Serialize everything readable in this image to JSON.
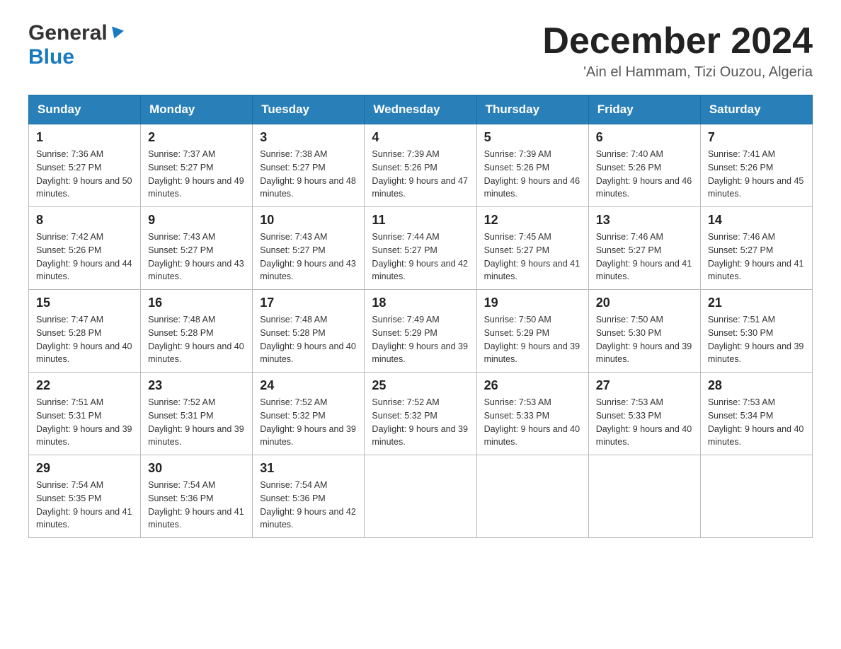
{
  "header": {
    "logo_general": "General",
    "logo_blue": "Blue",
    "title": "December 2024",
    "subtitle": "'Ain el Hammam, Tizi Ouzou, Algeria"
  },
  "weekdays": [
    "Sunday",
    "Monday",
    "Tuesday",
    "Wednesday",
    "Thursday",
    "Friday",
    "Saturday"
  ],
  "weeks": [
    [
      {
        "day": "1",
        "sunrise": "7:36 AM",
        "sunset": "5:27 PM",
        "daylight": "9 hours and 50 minutes."
      },
      {
        "day": "2",
        "sunrise": "7:37 AM",
        "sunset": "5:27 PM",
        "daylight": "9 hours and 49 minutes."
      },
      {
        "day": "3",
        "sunrise": "7:38 AM",
        "sunset": "5:27 PM",
        "daylight": "9 hours and 48 minutes."
      },
      {
        "day": "4",
        "sunrise": "7:39 AM",
        "sunset": "5:26 PM",
        "daylight": "9 hours and 47 minutes."
      },
      {
        "day": "5",
        "sunrise": "7:39 AM",
        "sunset": "5:26 PM",
        "daylight": "9 hours and 46 minutes."
      },
      {
        "day": "6",
        "sunrise": "7:40 AM",
        "sunset": "5:26 PM",
        "daylight": "9 hours and 46 minutes."
      },
      {
        "day": "7",
        "sunrise": "7:41 AM",
        "sunset": "5:26 PM",
        "daylight": "9 hours and 45 minutes."
      }
    ],
    [
      {
        "day": "8",
        "sunrise": "7:42 AM",
        "sunset": "5:26 PM",
        "daylight": "9 hours and 44 minutes."
      },
      {
        "day": "9",
        "sunrise": "7:43 AM",
        "sunset": "5:27 PM",
        "daylight": "9 hours and 43 minutes."
      },
      {
        "day": "10",
        "sunrise": "7:43 AM",
        "sunset": "5:27 PM",
        "daylight": "9 hours and 43 minutes."
      },
      {
        "day": "11",
        "sunrise": "7:44 AM",
        "sunset": "5:27 PM",
        "daylight": "9 hours and 42 minutes."
      },
      {
        "day": "12",
        "sunrise": "7:45 AM",
        "sunset": "5:27 PM",
        "daylight": "9 hours and 41 minutes."
      },
      {
        "day": "13",
        "sunrise": "7:46 AM",
        "sunset": "5:27 PM",
        "daylight": "9 hours and 41 minutes."
      },
      {
        "day": "14",
        "sunrise": "7:46 AM",
        "sunset": "5:27 PM",
        "daylight": "9 hours and 41 minutes."
      }
    ],
    [
      {
        "day": "15",
        "sunrise": "7:47 AM",
        "sunset": "5:28 PM",
        "daylight": "9 hours and 40 minutes."
      },
      {
        "day": "16",
        "sunrise": "7:48 AM",
        "sunset": "5:28 PM",
        "daylight": "9 hours and 40 minutes."
      },
      {
        "day": "17",
        "sunrise": "7:48 AM",
        "sunset": "5:28 PM",
        "daylight": "9 hours and 40 minutes."
      },
      {
        "day": "18",
        "sunrise": "7:49 AM",
        "sunset": "5:29 PM",
        "daylight": "9 hours and 39 minutes."
      },
      {
        "day": "19",
        "sunrise": "7:50 AM",
        "sunset": "5:29 PM",
        "daylight": "9 hours and 39 minutes."
      },
      {
        "day": "20",
        "sunrise": "7:50 AM",
        "sunset": "5:30 PM",
        "daylight": "9 hours and 39 minutes."
      },
      {
        "day": "21",
        "sunrise": "7:51 AM",
        "sunset": "5:30 PM",
        "daylight": "9 hours and 39 minutes."
      }
    ],
    [
      {
        "day": "22",
        "sunrise": "7:51 AM",
        "sunset": "5:31 PM",
        "daylight": "9 hours and 39 minutes."
      },
      {
        "day": "23",
        "sunrise": "7:52 AM",
        "sunset": "5:31 PM",
        "daylight": "9 hours and 39 minutes."
      },
      {
        "day": "24",
        "sunrise": "7:52 AM",
        "sunset": "5:32 PM",
        "daylight": "9 hours and 39 minutes."
      },
      {
        "day": "25",
        "sunrise": "7:52 AM",
        "sunset": "5:32 PM",
        "daylight": "9 hours and 39 minutes."
      },
      {
        "day": "26",
        "sunrise": "7:53 AM",
        "sunset": "5:33 PM",
        "daylight": "9 hours and 40 minutes."
      },
      {
        "day": "27",
        "sunrise": "7:53 AM",
        "sunset": "5:33 PM",
        "daylight": "9 hours and 40 minutes."
      },
      {
        "day": "28",
        "sunrise": "7:53 AM",
        "sunset": "5:34 PM",
        "daylight": "9 hours and 40 minutes."
      }
    ],
    [
      {
        "day": "29",
        "sunrise": "7:54 AM",
        "sunset": "5:35 PM",
        "daylight": "9 hours and 41 minutes."
      },
      {
        "day": "30",
        "sunrise": "7:54 AM",
        "sunset": "5:36 PM",
        "daylight": "9 hours and 41 minutes."
      },
      {
        "day": "31",
        "sunrise": "7:54 AM",
        "sunset": "5:36 PM",
        "daylight": "9 hours and 42 minutes."
      },
      null,
      null,
      null,
      null
    ]
  ]
}
